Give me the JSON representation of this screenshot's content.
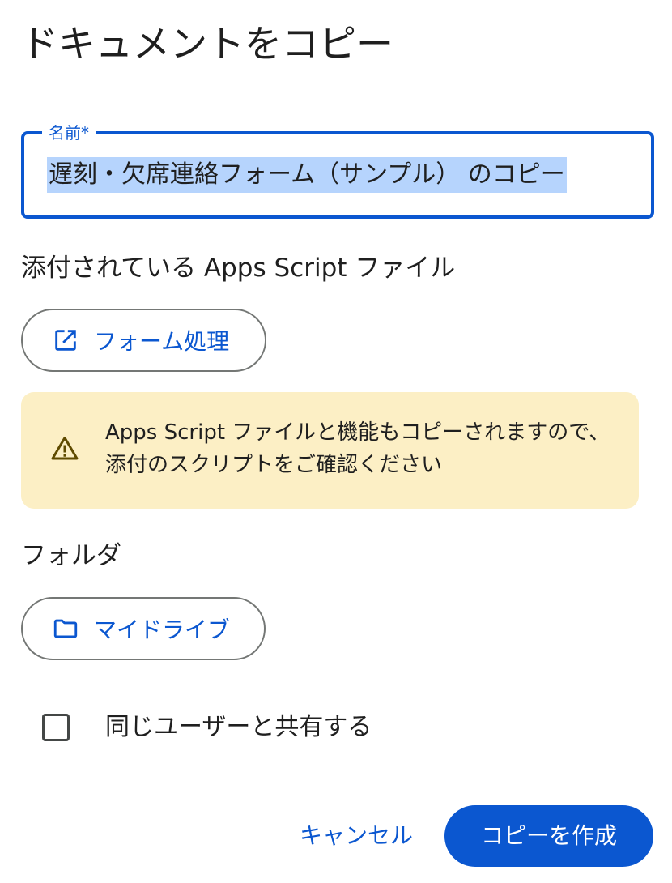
{
  "dialog": {
    "title": "ドキュメントをコピー"
  },
  "name_field": {
    "label": "名前*",
    "value": "遅刻・欠席連絡フォーム（サンプル） のコピー"
  },
  "scripts": {
    "label": "添付されている Apps Script ファイル",
    "chip_label": "フォーム処理",
    "chip_icon": "open-in-new-icon"
  },
  "warning": {
    "icon": "warning-icon",
    "text": "Apps Script ファイルと機能もコピーされますので、添付のスクリプトをご確認ください"
  },
  "folder": {
    "label": "フォルダ",
    "chip_label": "マイドライブ",
    "chip_icon": "folder-icon"
  },
  "share_checkbox": {
    "label": "同じユーザーと共有する",
    "checked": false
  },
  "actions": {
    "cancel_label": "キャンセル",
    "copy_label": "コピーを作成"
  },
  "colors": {
    "accent": "#0b57d0",
    "selection": "#b6d4fd",
    "warning_bg": "#fcefc5",
    "outline": "#747775"
  }
}
